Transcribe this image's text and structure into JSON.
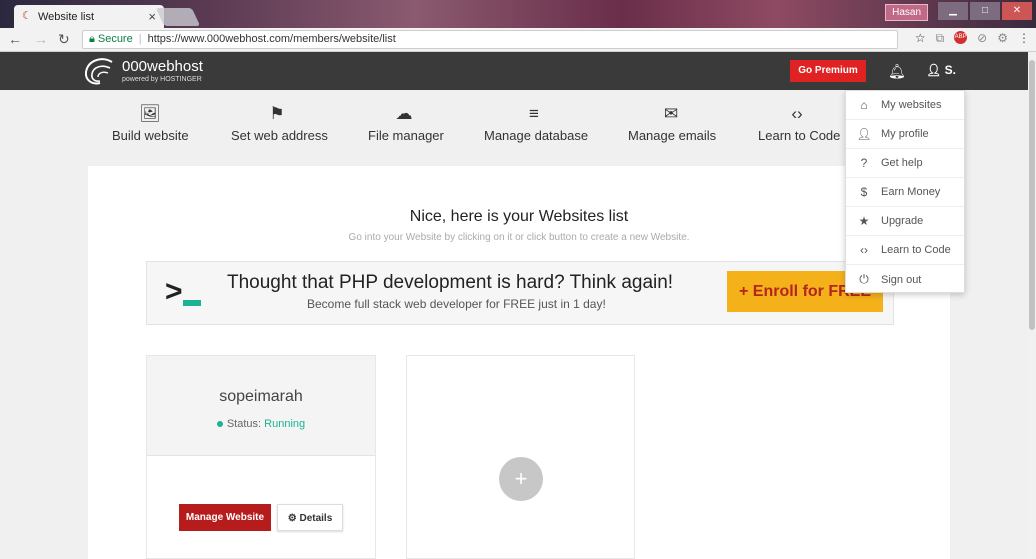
{
  "browser": {
    "tab_title": "Website list",
    "tab_close": "×",
    "window_user": "Hasan",
    "address": {
      "secure_label": "Secure",
      "url": "https://www.000webhost.com/members/website/list"
    }
  },
  "header": {
    "logo_name": "000webhost",
    "logo_sub": "powered by HOSTINGER",
    "premium_label": "Go Premium",
    "user_label": "S."
  },
  "nav": {
    "items": [
      {
        "label": "Build website",
        "icon": "image-icon"
      },
      {
        "label": "Set web address",
        "icon": "flag-icon"
      },
      {
        "label": "File manager",
        "icon": "cloud-upload-icon"
      },
      {
        "label": "Manage database",
        "icon": "database-icon"
      },
      {
        "label": "Manage emails",
        "icon": "envelope-icon"
      },
      {
        "label": "Learn to Code",
        "icon": "code-icon"
      }
    ]
  },
  "main": {
    "title": "Nice, here is your Websites list",
    "subtitle": "Go into your Website by clicking on it or click button to create a new Website.",
    "banner": {
      "title": "Thought that PHP development is hard? Think again!",
      "subtitle": "Become full stack web developer for FREE just in 1 day!",
      "cta": "+ Enroll for FREE"
    },
    "site": {
      "name": "sopeimarah",
      "status_label": "Status:",
      "status_value": "Running",
      "manage_label": "Manage Website",
      "details_label": "Details"
    },
    "add_label": "+"
  },
  "dropdown": {
    "items": [
      {
        "label": "My websites",
        "icon": "home-icon"
      },
      {
        "label": "My profile",
        "icon": "user-icon"
      },
      {
        "label": "Get help",
        "icon": "question-icon"
      },
      {
        "label": "Earn Money",
        "icon": "dollar-icon"
      },
      {
        "label": "Upgrade",
        "icon": "star-icon"
      },
      {
        "label": "Learn to Code",
        "icon": "code-icon"
      },
      {
        "label": "Sign out",
        "icon": "power-icon"
      }
    ]
  },
  "colors": {
    "header_bg": "#3a3a3a",
    "premium": "#e02222",
    "accent_green": "#1bb394",
    "enroll_bg": "#f5b11a",
    "manage_btn": "#b71c1c"
  }
}
